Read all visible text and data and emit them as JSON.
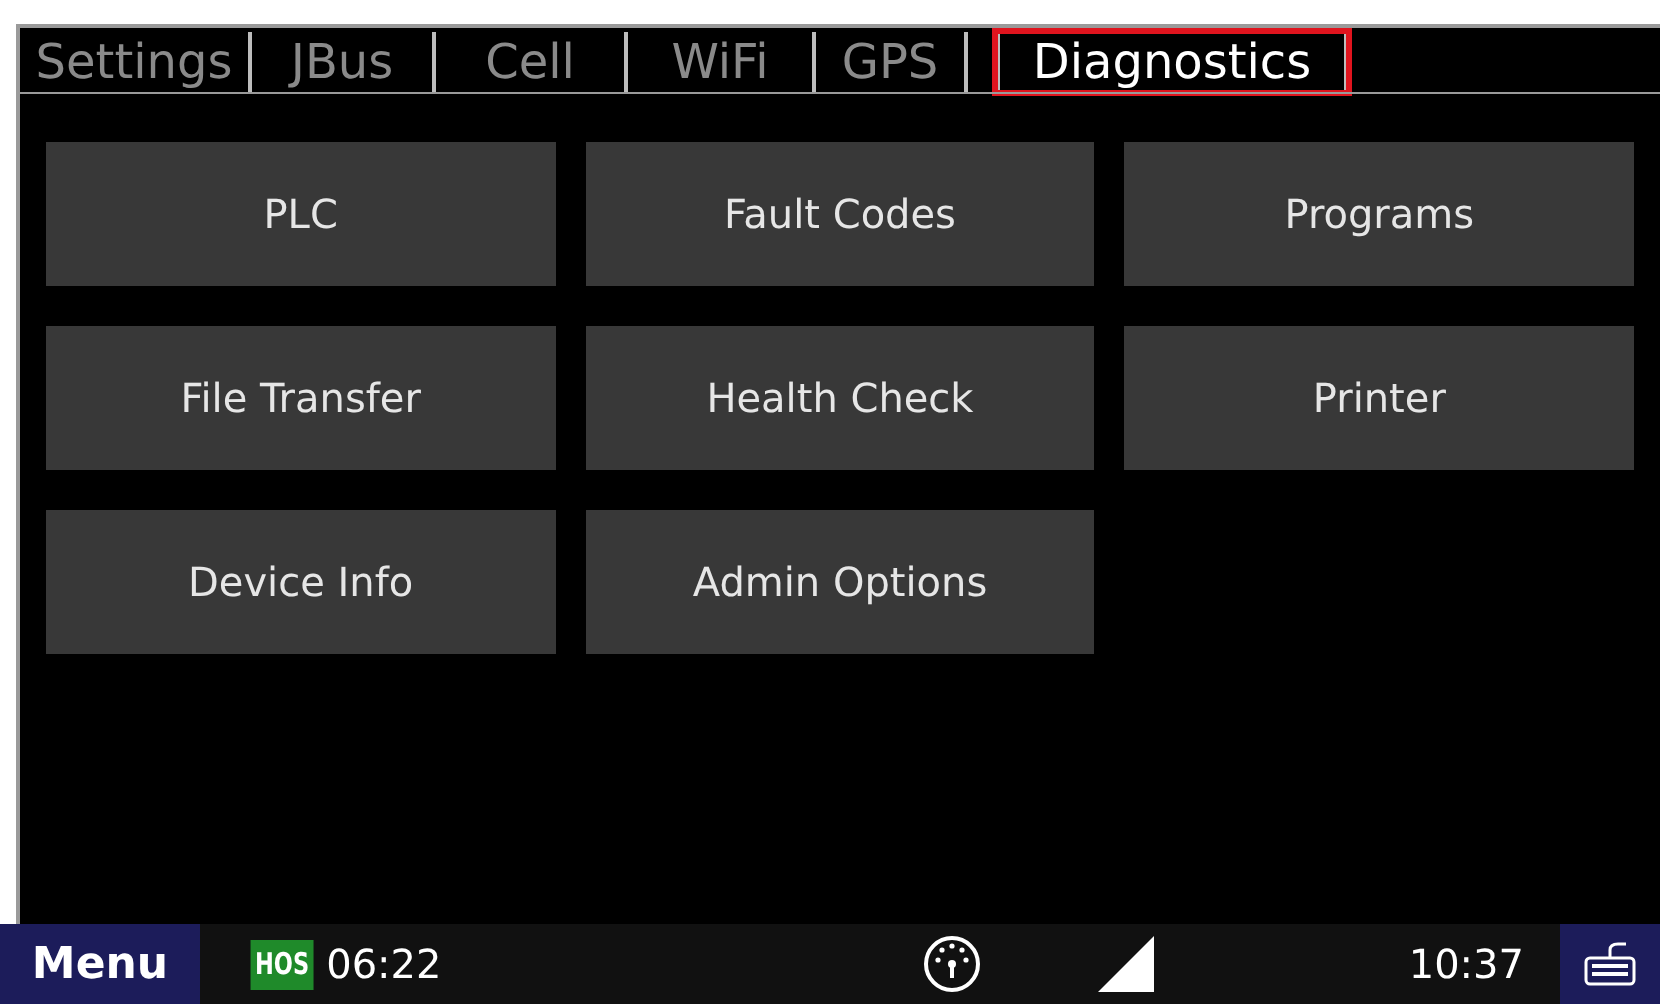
{
  "tabs": [
    {
      "label": "Settings",
      "selected": false
    },
    {
      "label": "JBus",
      "selected": false
    },
    {
      "label": "Cell",
      "selected": false
    },
    {
      "label": "WiFi",
      "selected": false
    },
    {
      "label": "GPS",
      "selected": false
    },
    {
      "label": "Diagnostics",
      "selected": true
    }
  ],
  "buttons": [
    "PLC",
    "Fault Codes",
    "Programs",
    "File Transfer",
    "Health Check",
    "Printer",
    "Device Info",
    "Admin Options"
  ],
  "status_bar": {
    "menu": "Menu",
    "hos_badge": "HOS",
    "hos_time": "06:22",
    "clock": "10:37"
  }
}
